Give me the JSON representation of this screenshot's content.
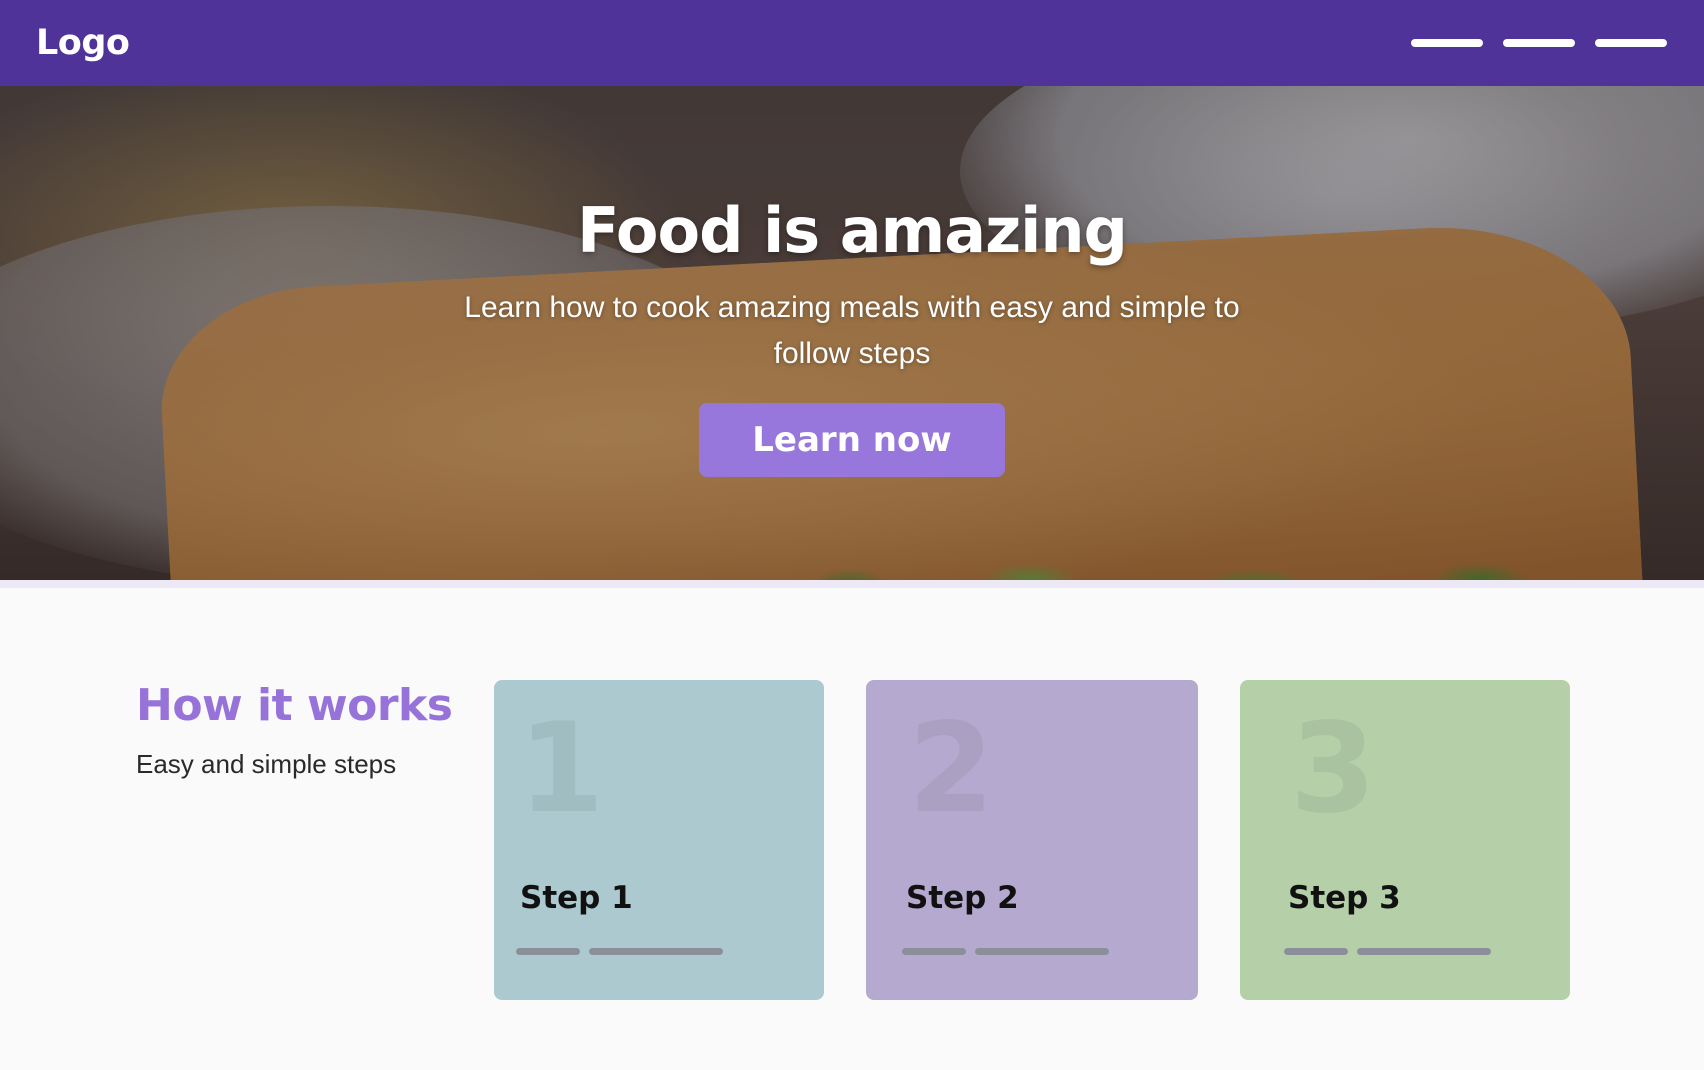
{
  "header": {
    "logo": "Logo",
    "nav_items": [
      "menu-item-1",
      "menu-item-2",
      "menu-item-3"
    ]
  },
  "hero": {
    "title": "Food is amazing",
    "subtitle": "Learn how to cook amazing meals with easy and simple to follow steps",
    "cta_label": "Learn now"
  },
  "how_it_works": {
    "title": "How it works",
    "subtitle": "Easy and simple steps",
    "steps": [
      {
        "number": "1",
        "title": "Step 1",
        "color": "#abc9cf"
      },
      {
        "number": "2",
        "title": "Step 2",
        "color": "#b6a9cf"
      },
      {
        "number": "3",
        "title": "Step 3",
        "color": "#b5cfa9"
      }
    ]
  },
  "colors": {
    "header_bg": "#4f3398",
    "accent": "#9777dc",
    "heading_accent": "#9672d9"
  }
}
